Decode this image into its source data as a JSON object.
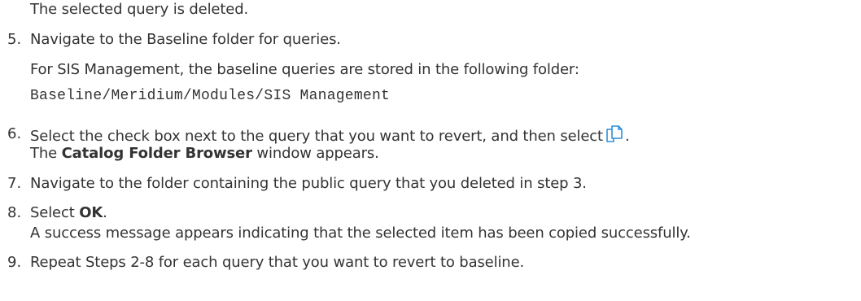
{
  "intro": {
    "text": "The selected query is deleted."
  },
  "steps": [
    {
      "number": "5.",
      "text": "Navigate to the Baseline folder for queries.",
      "note": "For SIS Management, the baseline queries are stored in the following folder:",
      "path": "Baseline/Meridium/Modules/SIS Management"
    },
    {
      "number": "6.",
      "text": "Select the check box next to the query that you want to revert, and then select",
      "icon": "copy-icon",
      "after_icon": ".",
      "result_bold": "Catalog Folder Browser",
      "result_rest": " window appears.",
      "result_prefix": "The "
    },
    {
      "number": "7.",
      "text": "Navigate to the folder containing the public query that you deleted in step 3."
    },
    {
      "number": "8.",
      "text_prefix": "Select ",
      "text_bold": "OK",
      "text_suffix": ".",
      "result": "A success message appears indicating that the selected item has been copied successfully."
    },
    {
      "number": "9.",
      "text": "Repeat Steps 2-8 for each query that you want to revert to baseline."
    }
  ],
  "colors": {
    "text": "#333333",
    "icon_blue": "#2f8fd8"
  }
}
